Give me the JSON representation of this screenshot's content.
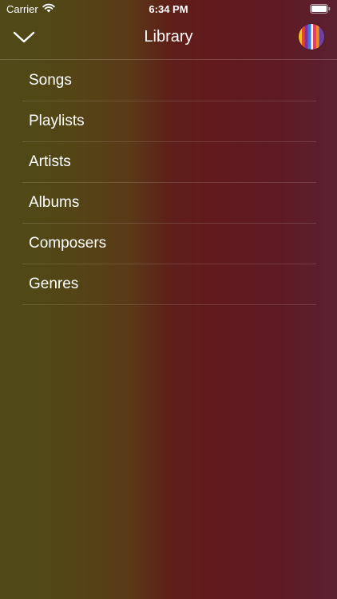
{
  "status_bar": {
    "carrier": "Carrier",
    "time": "6:34 PM",
    "icons": [
      "wifi-icon",
      "battery-icon"
    ]
  },
  "nav": {
    "title": "Library",
    "left_icon": "chevron-down-icon",
    "right_icon": "color-wheel-icon"
  },
  "library": {
    "items": [
      {
        "label": "Songs"
      },
      {
        "label": "Playlists"
      },
      {
        "label": "Artists"
      },
      {
        "label": "Albums"
      },
      {
        "label": "Composers"
      },
      {
        "label": "Genres"
      }
    ]
  },
  "colors": {
    "background_left": "#4f4a18",
    "background_right": "#5b2030",
    "text": "#ffffff"
  }
}
